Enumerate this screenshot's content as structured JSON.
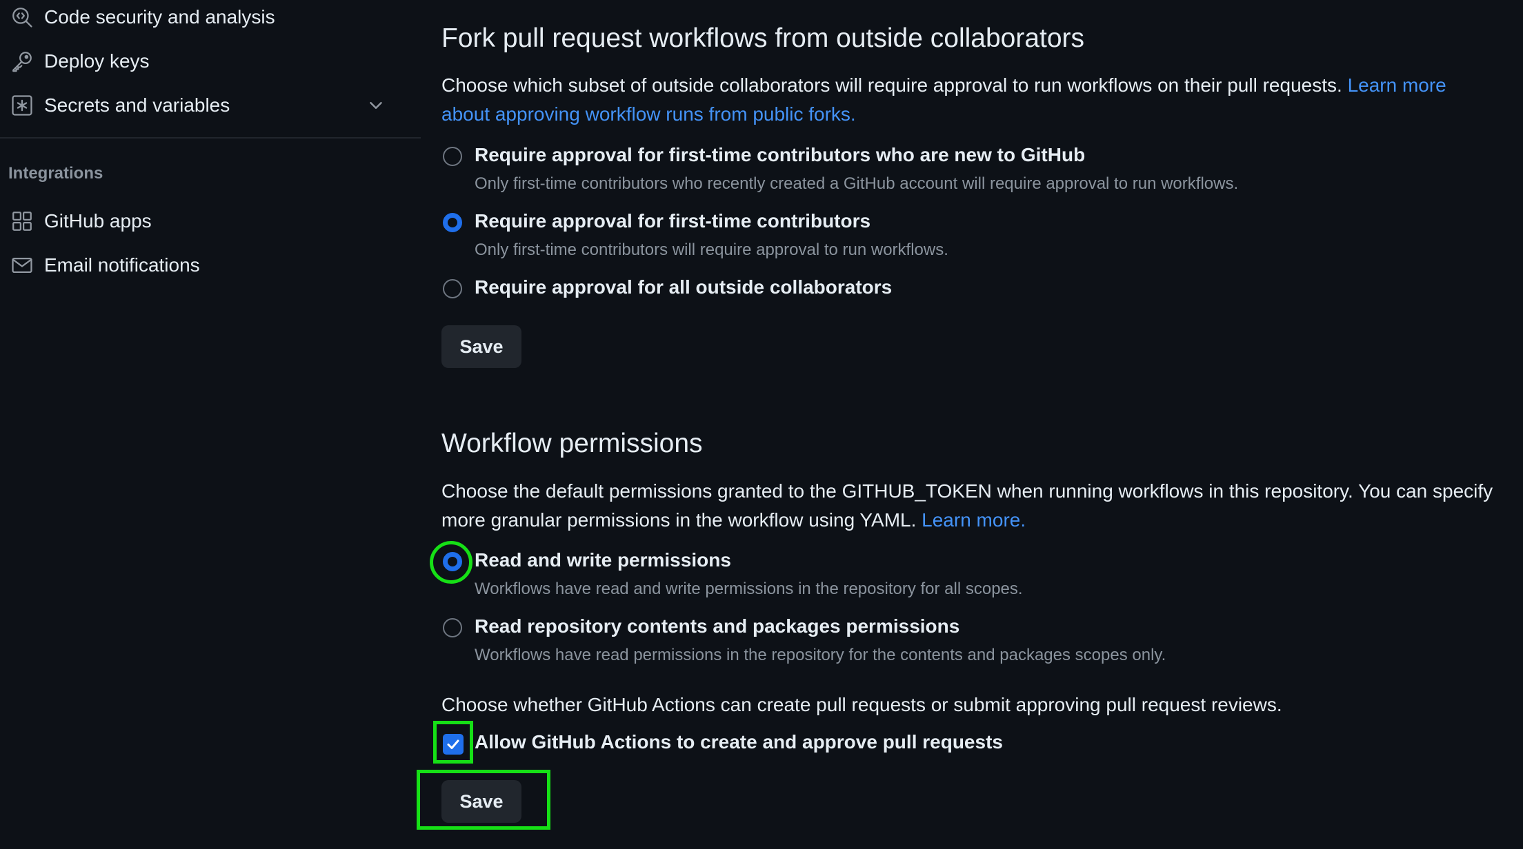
{
  "sidebar": {
    "items_top": [
      {
        "label": "Code security and analysis",
        "icon": "codescan-icon"
      },
      {
        "label": "Deploy keys",
        "icon": "key-icon"
      },
      {
        "label": "Secrets and variables",
        "icon": "key-asterisk-icon"
      }
    ],
    "integrations_heading": "Integrations",
    "items_integrations": [
      {
        "label": "GitHub apps",
        "icon": "apps-icon"
      },
      {
        "label": "Email notifications",
        "icon": "mail-icon"
      }
    ]
  },
  "fork_section": {
    "title": "Fork pull request workflows from outside collaborators",
    "description": "Choose which subset of outside collaborators will require approval to run workflows on their pull requests.",
    "link_text": "Learn more about approving workflow runs from public forks.",
    "options": [
      {
        "title": "Require approval for first-time contributors who are new to GitHub",
        "description": "Only first-time contributors who recently created a GitHub account will require approval to run workflows.",
        "checked": false
      },
      {
        "title": "Require approval for first-time contributors",
        "description": "Only first-time contributors will require approval to run workflows.",
        "checked": true
      },
      {
        "title": "Require approval for all outside collaborators",
        "description": "",
        "checked": false
      }
    ],
    "save_label": "Save"
  },
  "workflow_section": {
    "title": "Workflow permissions",
    "description": "Choose the default permissions granted to the GITHUB_TOKEN when running workflows in this repository. You can specify more granular permissions in the workflow using YAML.",
    "link_text": "Learn more.",
    "options": [
      {
        "title": "Read and write permissions",
        "description": "Workflows have read and write permissions in the repository for all scopes.",
        "checked": true
      },
      {
        "title": "Read repository contents and packages permissions",
        "description": "Workflows have read permissions in the repository for the contents and packages scopes only.",
        "checked": false
      }
    ],
    "pr_description": "Choose whether GitHub Actions can create pull requests or submit approving pull request reviews.",
    "checkbox_label": "Allow GitHub Actions to create and approve pull requests",
    "checkbox_checked": true,
    "save_label": "Save"
  },
  "colors": {
    "background": "#0d1117",
    "accent": "#1f6feb",
    "link": "#4493f8",
    "highlight": "#16e016"
  }
}
